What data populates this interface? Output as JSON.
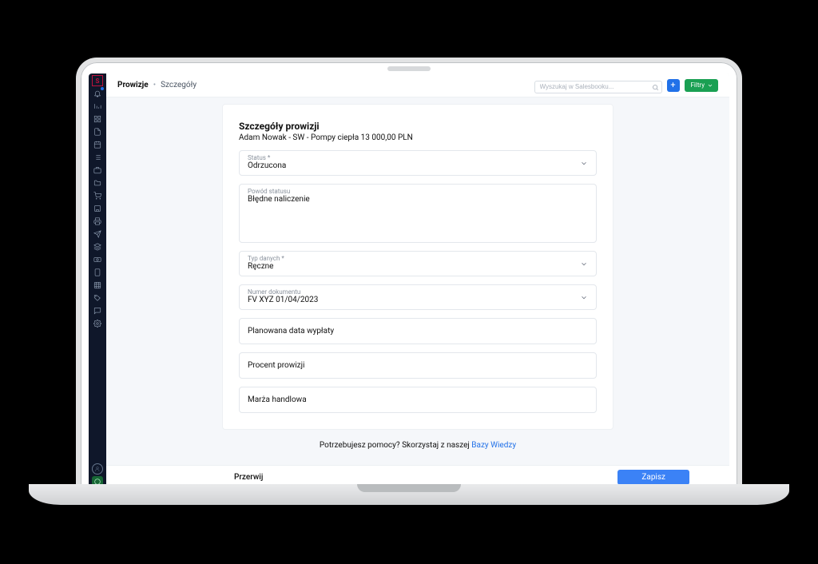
{
  "breadcrumb": {
    "root": "Prowizje",
    "sep": "•",
    "current": "Szczegóły"
  },
  "topbar": {
    "search_placeholder": "Wyszukaj w Salesbooku...",
    "filter_label": "Filtry"
  },
  "card": {
    "title": "Szczegóły prowizji",
    "subtitle": "Adam Nowak - SW - Pompy ciepła 13 000,00 PLN"
  },
  "fields": {
    "status": {
      "label": "Status *",
      "value": "Odrzucona"
    },
    "status_reason": {
      "label": "Powód statusu",
      "value": "Błędne naliczenie"
    },
    "data_type": {
      "label": "Typ danych *",
      "value": "Ręczne"
    },
    "doc_number": {
      "label": "Numer dokumentu",
      "value": "FV XYZ 01/04/2023"
    },
    "payout_date": {
      "placeholder": "Planowana data wypłaty"
    },
    "commission_pct": {
      "placeholder": "Procent prowizji"
    },
    "margin": {
      "placeholder": "Marża handlowa"
    }
  },
  "help": {
    "text": "Potrzebujesz pomocy? Skorzystaj z naszej",
    "link": "Bazy Wiedzy"
  },
  "actions": {
    "cancel": "Przerwij",
    "save": "Zapisz"
  },
  "sidebar_logo": "S"
}
